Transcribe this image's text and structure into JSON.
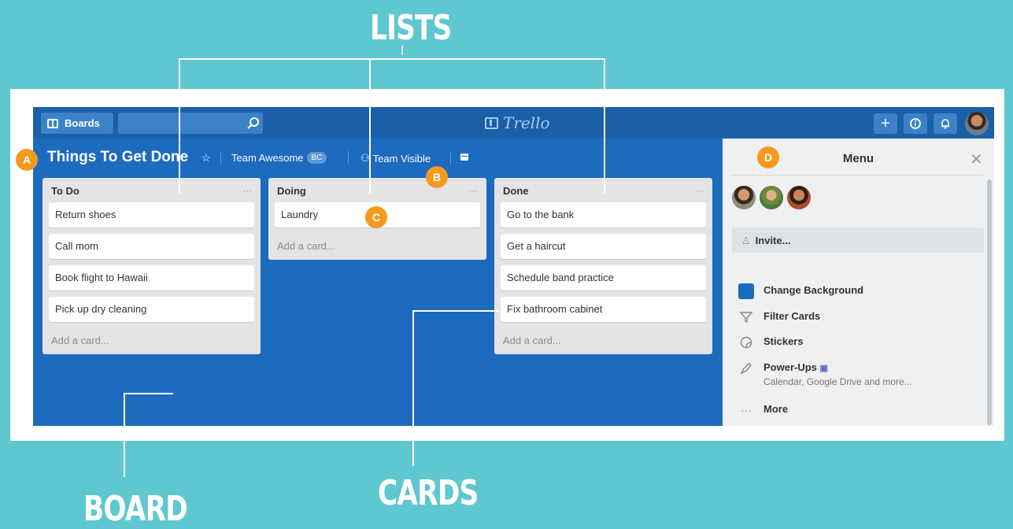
{
  "annotations": {
    "lists": "LISTS",
    "cards": "CARDS",
    "board": "BOARD",
    "badges": [
      "A",
      "B",
      "C",
      "D"
    ]
  },
  "header": {
    "boards_label": "Boards",
    "search_value": "",
    "logo_text": "Trello"
  },
  "board": {
    "title": "Things To Get Done",
    "team": "Team Awesome",
    "team_badge": "BC",
    "visibility": "Team Visible"
  },
  "lists": [
    {
      "title": "To Do",
      "menu": "···",
      "cards": [
        "Return shoes",
        "Call mom",
        "Book flight to Hawaii",
        "Pick up dry cleaning"
      ],
      "add": "Add a card..."
    },
    {
      "title": "Doing",
      "menu": "···",
      "cards": [
        "Laundry"
      ],
      "add": "Add a card..."
    },
    {
      "title": "Done",
      "menu": "···",
      "cards": [
        "Go to the bank",
        "Get a haircut",
        "Schedule band practice",
        "Fix bathroom cabinet"
      ],
      "add": "Add a card..."
    }
  ],
  "sidebar": {
    "title": "Menu",
    "invite": "Invite...",
    "items": [
      {
        "label": "Change Background"
      },
      {
        "label": "Filter Cards"
      },
      {
        "label": "Stickers"
      },
      {
        "label": "Power-Ups",
        "sub": "Calendar, Google Drive and more..."
      },
      {
        "label": "More"
      }
    ]
  },
  "colors": {
    "board_bg": "#1c6bbf",
    "header_bg": "#1a5fa8",
    "page_bg": "#5fc7cf",
    "badge": "#f49a1f"
  }
}
